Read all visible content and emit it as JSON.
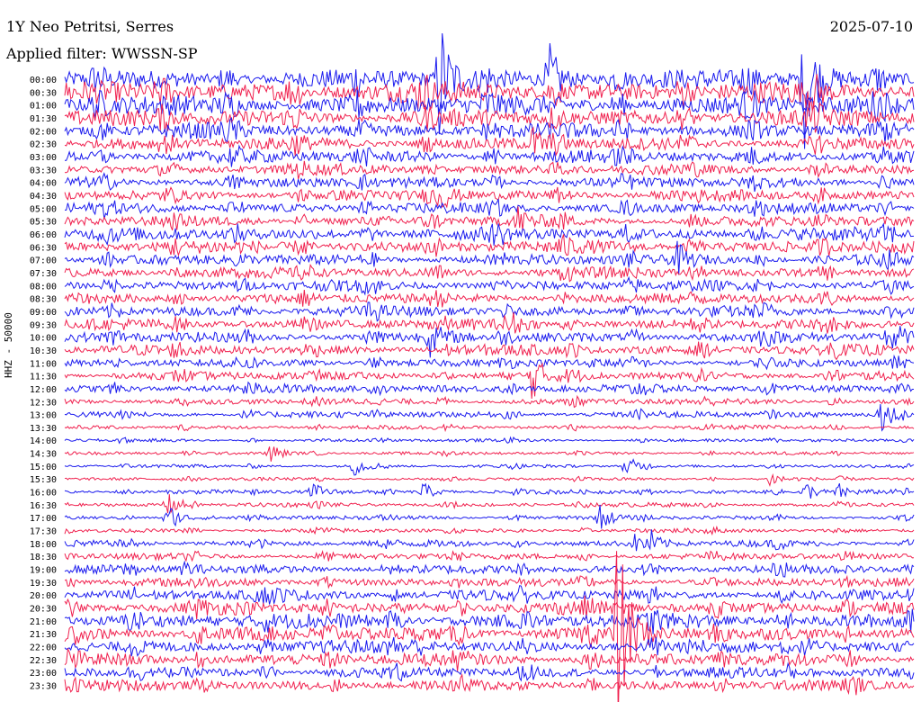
{
  "header": {
    "station": "1Y Neo Petritsi, Serres",
    "filter": "Applied filter: WWSSN-SP",
    "date": "2025-07-10",
    "channel": "HHZ - 50000"
  },
  "colors": {
    "odd_trace": "#1a1aee",
    "even_trace": "#f0204e",
    "text": "#000000"
  },
  "chart_data": {
    "type": "line",
    "title": "1Y Neo Petritsi, Serres",
    "subtitle": "Applied filter: WWSSN-SP",
    "ylabel": "HHZ - 50000",
    "rows": [
      "00:00",
      "00:30",
      "01:00",
      "01:30",
      "02:00",
      "02:30",
      "03:00",
      "03:30",
      "04:00",
      "04:30",
      "05:00",
      "05:30",
      "06:00",
      "06:30",
      "07:00",
      "07:30",
      "08:00",
      "08:30",
      "09:00",
      "09:30",
      "10:00",
      "10:30",
      "11:00",
      "11:30",
      "12:00",
      "12:30",
      "13:00",
      "13:30",
      "14:00",
      "14:30",
      "15:00",
      "15:30",
      "16:00",
      "16:30",
      "17:00",
      "17:30",
      "18:00",
      "18:30",
      "19:00",
      "19:30",
      "20:00",
      "20:30",
      "21:00",
      "21:30",
      "22:00",
      "22:30",
      "23:00",
      "23:30"
    ],
    "row_noise_amplitude": [
      9,
      10,
      9,
      8,
      7,
      6,
      6,
      5,
      5,
      5,
      5,
      5,
      6,
      6,
      5,
      5,
      5,
      5,
      5,
      5,
      5,
      5,
      4,
      4,
      4,
      3,
      3,
      2,
      1.5,
      1.5,
      1.5,
      1.5,
      2,
      2,
      2,
      2,
      3,
      3,
      4,
      4,
      5,
      6,
      7,
      7,
      6,
      6,
      5,
      5
    ],
    "events": [
      {
        "row": 0,
        "t": 0.44,
        "amp": 80
      },
      {
        "row": 0,
        "t": 0.87,
        "amp": 80
      },
      {
        "row": 0,
        "t": 0.57,
        "amp": 40
      },
      {
        "row": 5,
        "t": 0.55,
        "amp": 18
      },
      {
        "row": 9,
        "t": 0.44,
        "amp": 22
      },
      {
        "row": 11,
        "t": 0.53,
        "amp": 20
      },
      {
        "row": 14,
        "t": 0.72,
        "amp": 18
      },
      {
        "row": 19,
        "t": 0.52,
        "amp": 20
      },
      {
        "row": 20,
        "t": 0.43,
        "amp": 18
      },
      {
        "row": 20,
        "t": 0.97,
        "amp": 18
      },
      {
        "row": 23,
        "t": 0.55,
        "amp": 25
      },
      {
        "row": 26,
        "t": 0.96,
        "amp": 20
      },
      {
        "row": 29,
        "t": 0.24,
        "amp": 14
      },
      {
        "row": 30,
        "t": 0.34,
        "amp": 12
      },
      {
        "row": 30,
        "t": 0.66,
        "amp": 14
      },
      {
        "row": 31,
        "t": 0.83,
        "amp": 10
      },
      {
        "row": 32,
        "t": 0.29,
        "amp": 12
      },
      {
        "row": 32,
        "t": 0.42,
        "amp": 12
      },
      {
        "row": 32,
        "t": 0.87,
        "amp": 14
      },
      {
        "row": 32,
        "t": 0.91,
        "amp": 10
      },
      {
        "row": 33,
        "t": 0.12,
        "amp": 14
      },
      {
        "row": 34,
        "t": 0.12,
        "amp": 18
      },
      {
        "row": 34,
        "t": 0.63,
        "amp": 14
      },
      {
        "row": 36,
        "t": 0.67,
        "amp": 10
      },
      {
        "row": 36,
        "t": 0.69,
        "amp": 10
      },
      {
        "row": 38,
        "t": 0.14,
        "amp": 10
      },
      {
        "row": 40,
        "t": 0.24,
        "amp": 10
      },
      {
        "row": 43,
        "t": 0.65,
        "amp": 130
      },
      {
        "row": 44,
        "t": 0.41,
        "amp": 12
      },
      {
        "row": 44,
        "t": 0.87,
        "amp": 12
      }
    ]
  }
}
